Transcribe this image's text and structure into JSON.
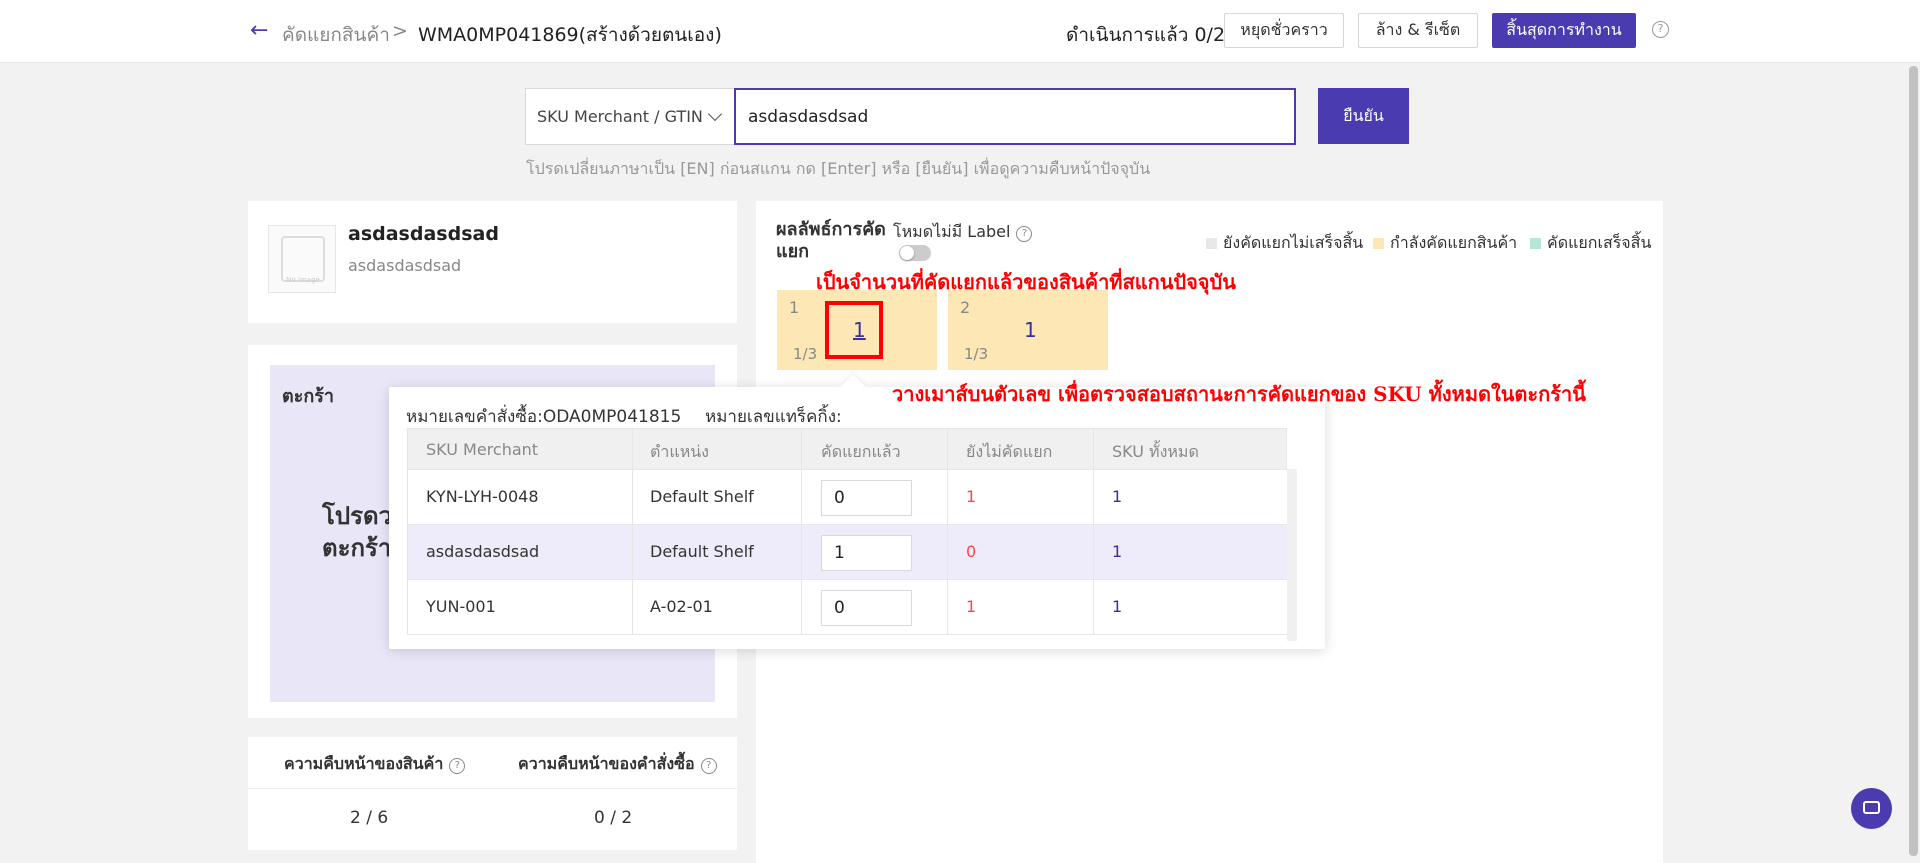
{
  "header": {
    "breadcrumb_parent": "คัดแยกสินค้า",
    "separator": ">",
    "breadcrumb_current": "WMA0MP041869(สร้างด้วยตนเอง)",
    "progress": "ดำเนินการแล้ว 0/2",
    "pause_label": "หยุดชั่วคราว",
    "reset_label": "ล้าง & รีเซ็ต",
    "finish_label": "สิ้นสุดการทำงาน",
    "help_icon": "?"
  },
  "scan": {
    "type_label": "SKU Merchant / GTIN",
    "input_value": "asdasdasdsad",
    "confirm_label": "ยืนยัน",
    "hint": "โปรดเปลี่ยนภาษาเป็น [EN] ก่อนสแกน กด [Enter] หรือ [ยืนยัน] เพื่อดูความคืบหน้าปัจจุบัน"
  },
  "product": {
    "image_placeholder": "No Image",
    "title": "asdasdasdsad",
    "subtitle": "asdasdasdsad"
  },
  "basket_panel": {
    "label": "ตะกร้า",
    "message_line1": "โปรดว",
    "message_line2": "ตะกร้า"
  },
  "stats": {
    "product_progress_label": "ความคืบหน้าของสินค้า",
    "order_progress_label": "ความคืบหน้าของคำสั่งซื้อ",
    "product_progress_value": "2 / 6",
    "order_progress_value": "0 / 2",
    "help_icon": "?"
  },
  "results": {
    "title": "ผลลัพธ์การคัดแยก",
    "mode_label": "โหมดไม่มี Label",
    "help_icon": "?",
    "legend": [
      {
        "label": "ยังคัดแยกไม่เสร็จสิ้น",
        "color": "#e8e8e8"
      },
      {
        "label": "กำลังคัดแยกสินค้า",
        "color": "#fde7b4"
      },
      {
        "label": "คัดแยกเสร็จสิ้น",
        "color": "#b8e6d4"
      }
    ],
    "baskets": [
      {
        "number": "1",
        "value": "1",
        "fraction": "1/3"
      },
      {
        "number": "2",
        "value": "1",
        "fraction": "1/3"
      }
    ]
  },
  "annotations": {
    "top": "เป็นจำนวนที่คัดแยกแล้วของสินค้าที่สแกนปัจจุบัน",
    "bottom": "วางเมาส์บนตัวเลข เพื่อตรวจสอบสถานะการคัดแยกของ SKU ทั้งหมดในตะกร้านี้"
  },
  "popover": {
    "order_no": "หมายเลขคำสั่งซื้อ:ODA0MP041815",
    "tracking_no": "หมายเลขแทร็คกิ้ง:",
    "columns": [
      "SKU Merchant",
      "ตำแหน่ง",
      "คัดแยกแล้ว",
      "ยังไม่คัดแยก",
      "SKU ทั้งหมด"
    ],
    "rows": [
      {
        "sku": "KYN-LYH-0048",
        "location": "Default Shelf",
        "sorted": "0",
        "unsorted": "1",
        "total": "1"
      },
      {
        "sku": "asdasdasdsad",
        "location": "Default Shelf",
        "sorted": "1",
        "unsorted": "0",
        "total": "1"
      },
      {
        "sku": "YUN-001",
        "location": "A-02-01",
        "sorted": "0",
        "unsorted": "1",
        "total": "1"
      }
    ]
  },
  "colors": {
    "accent": "#4a3bb0",
    "basket_active": "#fde7b4",
    "annotation": "#ff0000"
  }
}
